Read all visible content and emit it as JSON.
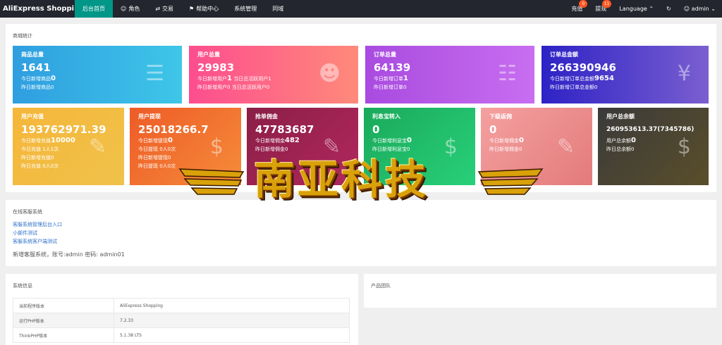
{
  "topbar": {
    "brand": "AliExpress Shopping...",
    "nav": [
      {
        "label": "后台首页",
        "icon": "",
        "active": true
      },
      {
        "label": "角色",
        "icon": "user-icon"
      },
      {
        "label": "交易",
        "icon": "exchange-icon"
      },
      {
        "label": "帮助中心",
        "icon": "flag-icon"
      },
      {
        "label": "系统管理",
        "icon": ""
      },
      {
        "label": "同域",
        "icon": ""
      }
    ],
    "right": {
      "recharge_label": "充值",
      "recharge_badge": "0",
      "withdraw_label": "提现",
      "withdraw_badge": "11",
      "language_label": "Language",
      "refresh_icon": "refresh-icon",
      "user_label": "admin"
    }
  },
  "stats": {
    "title": "商城统计",
    "cards": [
      {
        "label": "商品总量",
        "value": "1641",
        "lines": [
          [
            "今日新增商品",
            "0"
          ],
          [
            "昨日新增商品",
            "0"
          ]
        ],
        "icon": "layers-icon"
      },
      {
        "label": "用户总量",
        "value": "29983",
        "lines": [
          [
            "今日新增用户",
            "1",
            " 当日总活跃用户1"
          ],
          [
            "昨日新增用户",
            "0",
            " 当日总活跃用户0"
          ]
        ],
        "icon": "users-icon"
      },
      {
        "label": "订单总量",
        "value": "64139",
        "lines": [
          [
            "今日新增订单",
            "1"
          ],
          [
            "昨日新增订单",
            "0"
          ]
        ],
        "icon": "book-icon"
      },
      {
        "label": "订单总金额",
        "value": "266390946",
        "lines": [
          [
            "今日新增订单总金额",
            "9654"
          ],
          [
            "昨日新增订单总金额",
            "0"
          ]
        ],
        "icon": "yen-icon"
      },
      {
        "label": "用户充值",
        "value": "193762971.39",
        "lines": [
          [
            "今日新增充值",
            "10000"
          ],
          [
            "今日充值 1人1次",
            ""
          ],
          [
            "昨日新增充值",
            "0"
          ],
          [
            "昨日充值 0人0次",
            ""
          ]
        ],
        "icon": "edit-icon"
      },
      {
        "label": "用户提现",
        "value": "25018266.7",
        "lines": [
          [
            "今日新增提现",
            "0"
          ],
          [
            "今日提现 0人0次",
            ""
          ],
          [
            "昨日新增提现",
            "0"
          ],
          [
            "昨日提现 0人0次",
            ""
          ]
        ],
        "icon": "dollar-icon"
      },
      {
        "label": "抢单佣金",
        "value": "47783687",
        "lines": [
          [
            "今日新增佣金",
            "482"
          ],
          [
            "昨日新增佣金",
            "0"
          ]
        ],
        "icon": "edit-icon"
      },
      {
        "label": "利息宝转入",
        "value": "0",
        "lines": [
          [
            "今日新增利息宝",
            "0"
          ],
          [
            "昨日新增利息宝",
            "0"
          ]
        ],
        "icon": "dollar-icon"
      },
      {
        "label": "下级返佣",
        "value": "0",
        "lines": [
          [
            "今日新增佣金",
            "0"
          ],
          [
            "昨日新增佣金",
            "0"
          ]
        ],
        "icon": "edit-icon"
      },
      {
        "label": "用户总余额",
        "value": "260953613.37(7345786)",
        "lines": [
          [
            "用户总余额",
            "0"
          ],
          [
            "昨日总余额",
            "0"
          ]
        ],
        "icon": "dollar-icon"
      }
    ]
  },
  "customer_service": {
    "title": "在线客服系统",
    "links": [
      "客服系统管理后台入口",
      "小部件测试",
      "客服系统客户端测试"
    ],
    "note": "新增客服系统，账号:admin 密码: admin01"
  },
  "sysinfo": {
    "title": "系统信息",
    "rows": [
      [
        "当前程序版本",
        "AliExpress Shopping"
      ],
      [
        "运行PHP版本",
        "7.2.33"
      ],
      [
        "ThinkPHP版本",
        "5.1.38 LTS"
      ]
    ]
  },
  "team": {
    "title": "产品团队"
  },
  "watermark": {
    "text": "南亚科技"
  }
}
